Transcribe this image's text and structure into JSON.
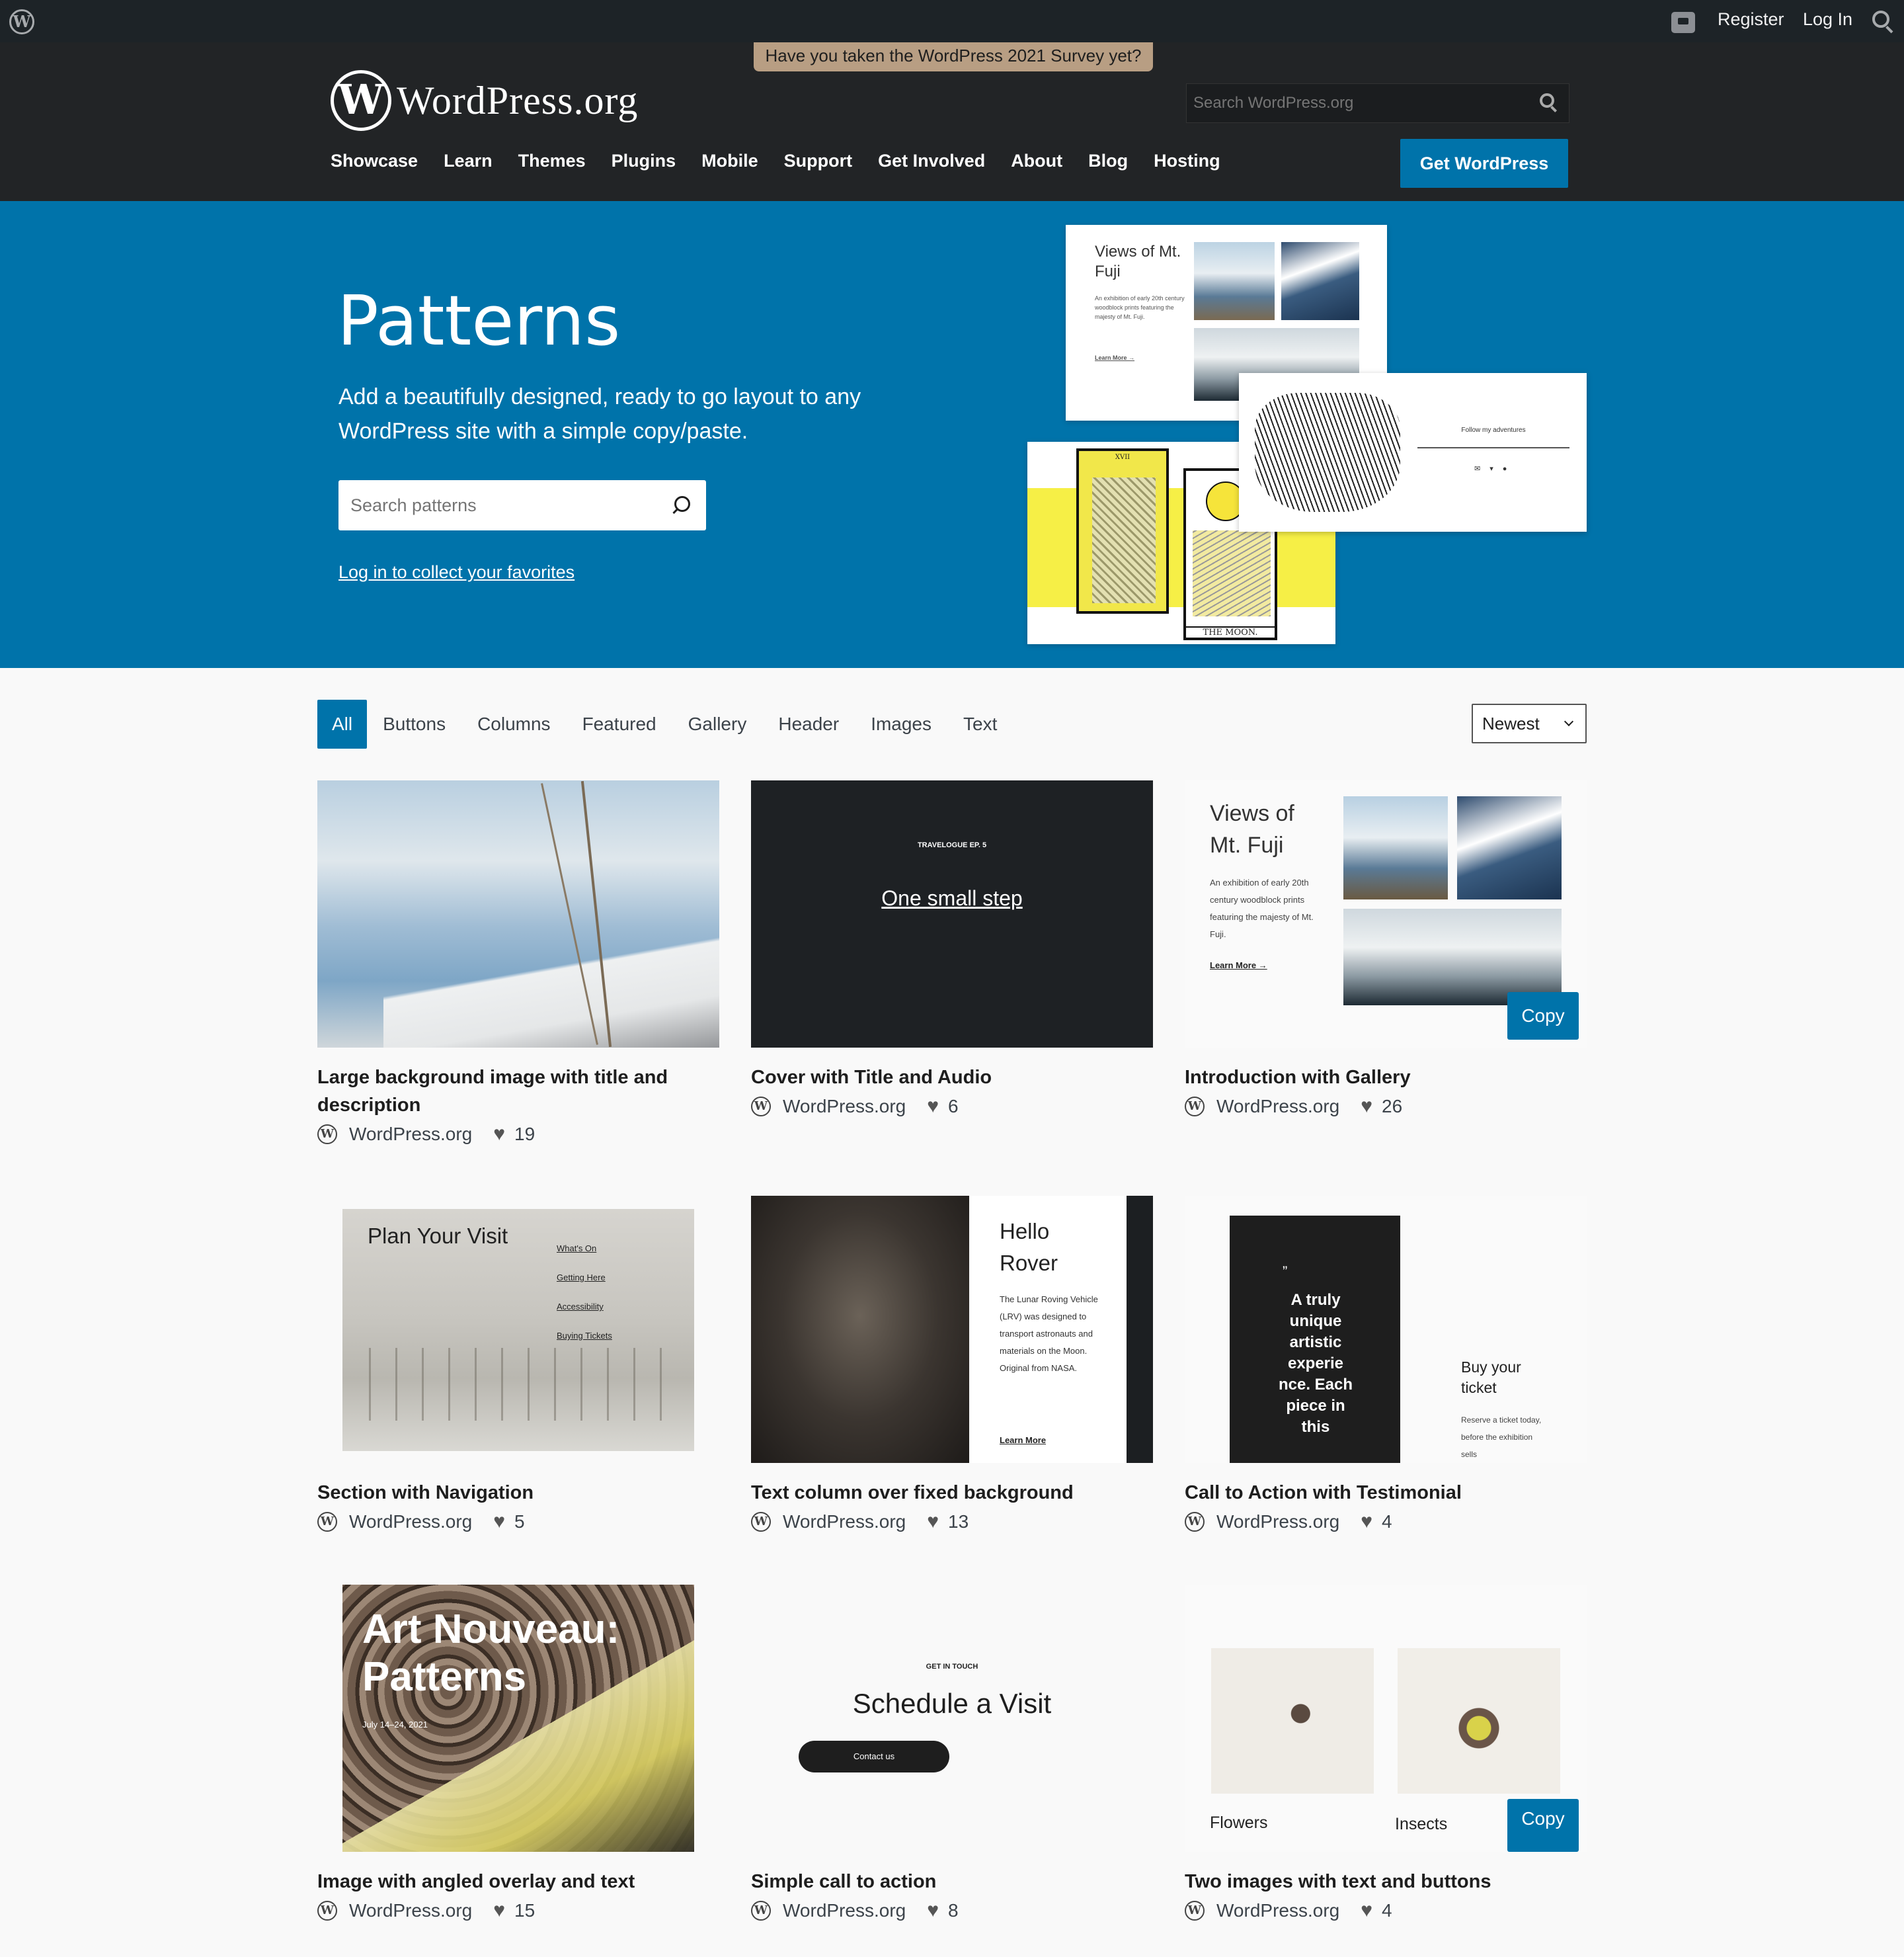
{
  "admin_bar": {
    "register": "Register",
    "login": "Log In"
  },
  "header": {
    "survey": "Have you taken the WordPress 2021 Survey yet?",
    "logo_text": "WordPress.org",
    "logo_w": "W",
    "search_placeholder": "Search WordPress.org",
    "nav": [
      "Showcase",
      "Learn",
      "Themes",
      "Plugins",
      "Mobile",
      "Support",
      "Get Involved",
      "About",
      "Blog",
      "Hosting"
    ],
    "cta": "Get WordPress"
  },
  "hero": {
    "title": "Patterns",
    "lead": "Add a beautifully designed, ready to go layout to any WordPress site with a simple copy/paste.",
    "search_placeholder": "Search patterns",
    "fav_link": "Log in to collect your favorites",
    "collage": {
      "fuji_title": "Views of Mt. Fuji",
      "fuji_text": "An exhibition of early 20th century woodblock prints featuring the majesty of Mt. Fuji.",
      "fuji_link": "Learn More →",
      "follow": "Follow my adventures",
      "moon": "THE MOON.",
      "card_numeral": "XVII"
    }
  },
  "filters": {
    "items": [
      "All",
      "Buttons",
      "Columns",
      "Featured",
      "Gallery",
      "Header",
      "Images",
      "Text"
    ],
    "active": "All",
    "sort": "Newest"
  },
  "patterns": [
    {
      "title": "Large background image with title and description",
      "author": "WordPress.org",
      "likes": "19"
    },
    {
      "title": "Cover with Title and Audio",
      "author": "WordPress.org",
      "likes": "6",
      "thumb": {
        "eyebrow": "TRAVELOGUE EP. 5",
        "heading": "One small step"
      }
    },
    {
      "title": "Introduction with Gallery",
      "author": "WordPress.org",
      "likes": "26",
      "thumb": {
        "heading": "Views of Mt. Fuji",
        "text": "An exhibition of early 20th century woodblock prints featuring the majesty of Mt. Fuji.",
        "link": "Learn More →",
        "copy": "Copy"
      }
    },
    {
      "title": "Section with Navigation",
      "author": "WordPress.org",
      "likes": "5",
      "thumb": {
        "heading": "Plan Your Visit",
        "links": [
          "What's On",
          "Getting Here",
          "Accessibility",
          "Buying Tickets"
        ]
      }
    },
    {
      "title": "Text column over fixed background",
      "author": "WordPress.org",
      "likes": "13",
      "thumb": {
        "heading": "Hello Rover",
        "text": "The Lunar Roving Vehicle (LRV) was designed to transport astronauts and materials on the Moon. Original from NASA.",
        "link": "Learn More"
      }
    },
    {
      "title": "Call to Action with Testimonial",
      "author": "WordPress.org",
      "likes": "4",
      "thumb": {
        "quote_mark": "”",
        "quote": "A truly unique artistic experie nce. Each piece in this",
        "heading": "Buy your ticket",
        "text": "Reserve a ticket today, before the exhibition sells"
      }
    },
    {
      "title": "Image with angled overlay and text",
      "author": "WordPress.org",
      "likes": "15",
      "thumb": {
        "heading": "Art Nouveau: Patterns",
        "date": "July 14–24, 2021"
      }
    },
    {
      "title": "Simple call to action",
      "author": "WordPress.org",
      "likes": "8",
      "thumb": {
        "eyebrow": "GET IN TOUCH",
        "heading": "Schedule a Visit",
        "button": "Contact us"
      }
    },
    {
      "title": "Two images with text and buttons",
      "author": "WordPress.org",
      "likes": "4",
      "thumb": {
        "caption1": "Flowers",
        "caption2": "Insects",
        "copy": "Copy"
      }
    }
  ],
  "colors": {
    "brand_blue": "#0073aa",
    "header_bg": "#222426",
    "admin_bg": "#1d2327"
  }
}
